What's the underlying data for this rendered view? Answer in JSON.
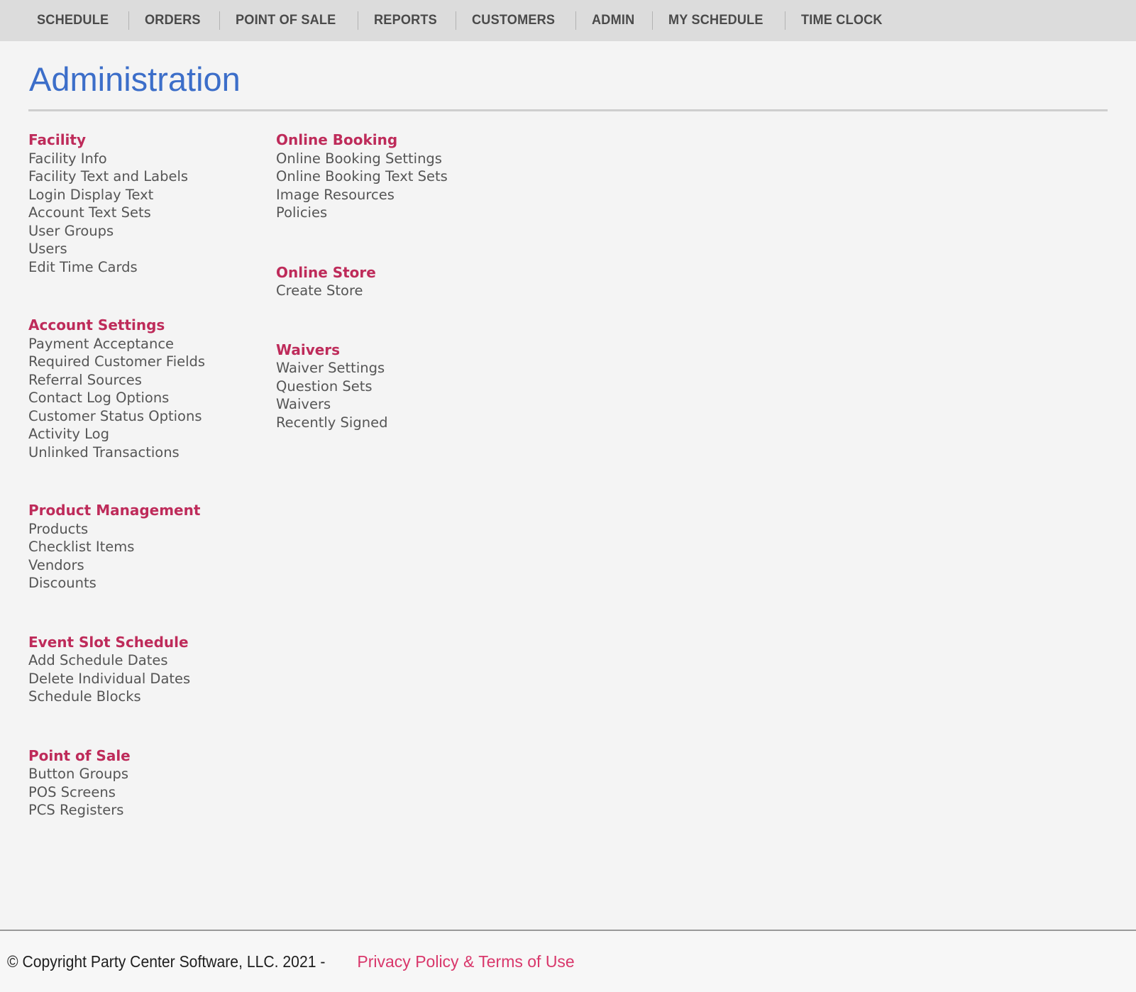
{
  "nav": {
    "items": [
      {
        "label": "SCHEDULE"
      },
      {
        "label": "ORDERS"
      },
      {
        "label": "POINT OF SALE"
      },
      {
        "label": "REPORTS"
      },
      {
        "label": "CUSTOMERS"
      },
      {
        "label": "ADMIN"
      },
      {
        "label": "MY SCHEDULE"
      },
      {
        "label": "TIME CLOCK"
      }
    ]
  },
  "page": {
    "title": "Administration"
  },
  "colors": {
    "title": "#3c6ec9",
    "heading": "#be2b5a",
    "link": "#d9376b",
    "nav_bg": "#dcdcdc",
    "body_bg": "#f4f4f4",
    "text": "#555555"
  },
  "left_column": {
    "facility": {
      "heading": "Facility",
      "items": [
        "Facility Info",
        "Facility Text and Labels",
        "Login Display Text",
        "Account Text Sets",
        "User Groups",
        "Users",
        "Edit Time Cards"
      ]
    },
    "account_settings": {
      "heading": "Account Settings",
      "items": [
        "Payment Acceptance",
        "Required Customer Fields",
        "Referral Sources",
        "Contact Log Options",
        "Customer Status Options",
        "Activity Log",
        "Unlinked Transactions"
      ]
    },
    "product_management": {
      "heading": "Product Management",
      "items": [
        "Products",
        "Checklist Items",
        "Vendors",
        "Discounts"
      ]
    },
    "event_slot_schedule": {
      "heading": "Event Slot Schedule",
      "items": [
        "Add Schedule Dates",
        "Delete Individual Dates",
        "Schedule Blocks"
      ]
    },
    "point_of_sale": {
      "heading": "Point of Sale",
      "items": [
        "Button Groups",
        "POS Screens",
        "PCS Registers"
      ]
    }
  },
  "right_column": {
    "online_booking": {
      "heading": "Online Booking",
      "items": [
        "Online Booking Settings",
        "Online Booking Text Sets",
        "Image Resources",
        "Policies"
      ]
    },
    "online_store": {
      "heading": "Online Store",
      "items": [
        "Create Store"
      ]
    },
    "waivers": {
      "heading": "Waivers",
      "items": [
        "Waiver Settings",
        "Question Sets",
        "Waivers",
        "Recently Signed"
      ]
    }
  },
  "footer": {
    "copyright": "© Copyright Party Center Software, LLC. 2021 -",
    "link": "Privacy Policy & Terms of Use"
  }
}
